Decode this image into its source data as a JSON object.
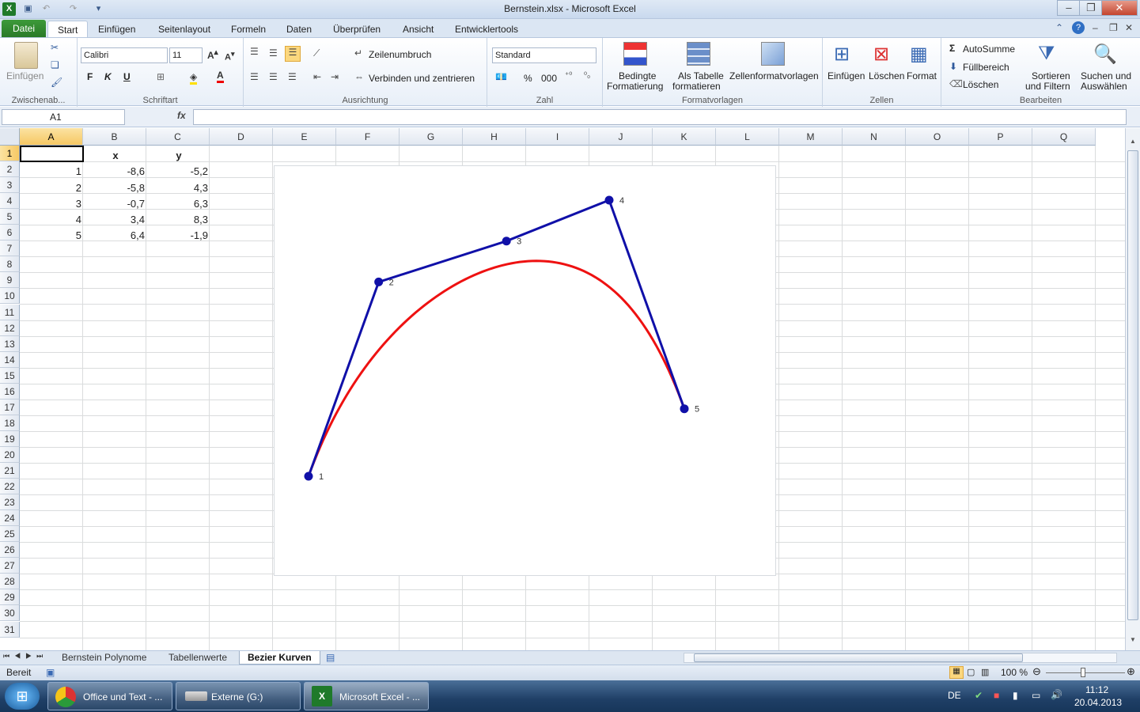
{
  "window": {
    "title": "Bernstein.xlsx  -  Microsoft Excel"
  },
  "tabs": [
    "Datei",
    "Start",
    "Einfügen",
    "Seitenlayout",
    "Formeln",
    "Daten",
    "Überprüfen",
    "Ansicht",
    "Entwicklertools"
  ],
  "ribbon": {
    "clipboard": {
      "paste": "Einfügen",
      "label": "Zwischenab..."
    },
    "font": {
      "name": "Calibri",
      "size": "11",
      "bold": "F",
      "italic": "K",
      "underline": "U",
      "label": "Schriftart"
    },
    "alignment": {
      "wrap": "Zeilenumbruch",
      "merge": "Verbinden und zentrieren",
      "label": "Ausrichtung"
    },
    "number": {
      "format": "Standard",
      "percent": "%",
      "thousands": "000",
      "label": "Zahl"
    },
    "styles": {
      "conditional1": "Bedingte",
      "conditional2": "Formatierung",
      "table1": "Als Tabelle",
      "table2": "formatieren",
      "cellstyles": "Zellenformatvorlagen",
      "label": "Formatvorlagen"
    },
    "cells": {
      "insert": "Einfügen",
      "delete": "Löschen",
      "format": "Format",
      "label": "Zellen"
    },
    "editing": {
      "autosum": "AutoSumme",
      "fill": "Füllbereich",
      "clear": "Löschen",
      "sort1": "Sortieren",
      "sort2": "und Filtern",
      "find1": "Suchen und",
      "find2": "Auswählen",
      "label": "Bearbeiten"
    }
  },
  "formula_bar": {
    "name_box": "A1",
    "fx": "fx",
    "value": ""
  },
  "columns": [
    "A",
    "B",
    "C",
    "D",
    "E",
    "F",
    "G",
    "H",
    "I",
    "J",
    "K",
    "L",
    "M",
    "N",
    "O",
    "P",
    "Q"
  ],
  "rows": [
    "1",
    "2",
    "3",
    "4",
    "5",
    "6",
    "7",
    "8",
    "9",
    "10",
    "11",
    "12",
    "13",
    "14",
    "15",
    "16",
    "17",
    "18",
    "19",
    "20",
    "21",
    "22",
    "23",
    "24",
    "25",
    "26",
    "27",
    "28",
    "29",
    "30",
    "31"
  ],
  "cells": {
    "headers": {
      "b1": "x",
      "c1": "y"
    },
    "data": [
      {
        "a": "1",
        "b": "-8,6",
        "c": "-5,2"
      },
      {
        "a": "2",
        "b": "-5,8",
        "c": "4,3"
      },
      {
        "a": "3",
        "b": "-0,7",
        "c": "6,3"
      },
      {
        "a": "4",
        "b": "3,4",
        "c": "8,3"
      },
      {
        "a": "5",
        "b": "6,4",
        "c": "-1,9"
      }
    ]
  },
  "chart_data": {
    "type": "scatter",
    "series": [
      {
        "name": "",
        "kind": "polygon",
        "color": "#1010a8",
        "x": [
          -8.6,
          -5.8,
          -0.7,
          3.4,
          6.4
        ],
        "y": [
          -5.2,
          4.3,
          6.3,
          8.3,
          -1.9
        ],
        "labels": [
          "1",
          "2",
          "3",
          "4",
          "5"
        ]
      },
      {
        "name": "",
        "kind": "bezier-curve",
        "color": "#ee1111"
      }
    ]
  },
  "sheet_tabs": [
    "Bernstein Polynome",
    "Tabellenwerte",
    "Bezier Kurven"
  ],
  "status": {
    "ready": "Bereit",
    "zoom": "100 %"
  },
  "taskbar": {
    "items": [
      "Office und Text - ...",
      "Externe (G:)",
      "Microsoft Excel - ..."
    ],
    "lang": "DE",
    "time": "11:12",
    "date": "20.04.2013"
  }
}
